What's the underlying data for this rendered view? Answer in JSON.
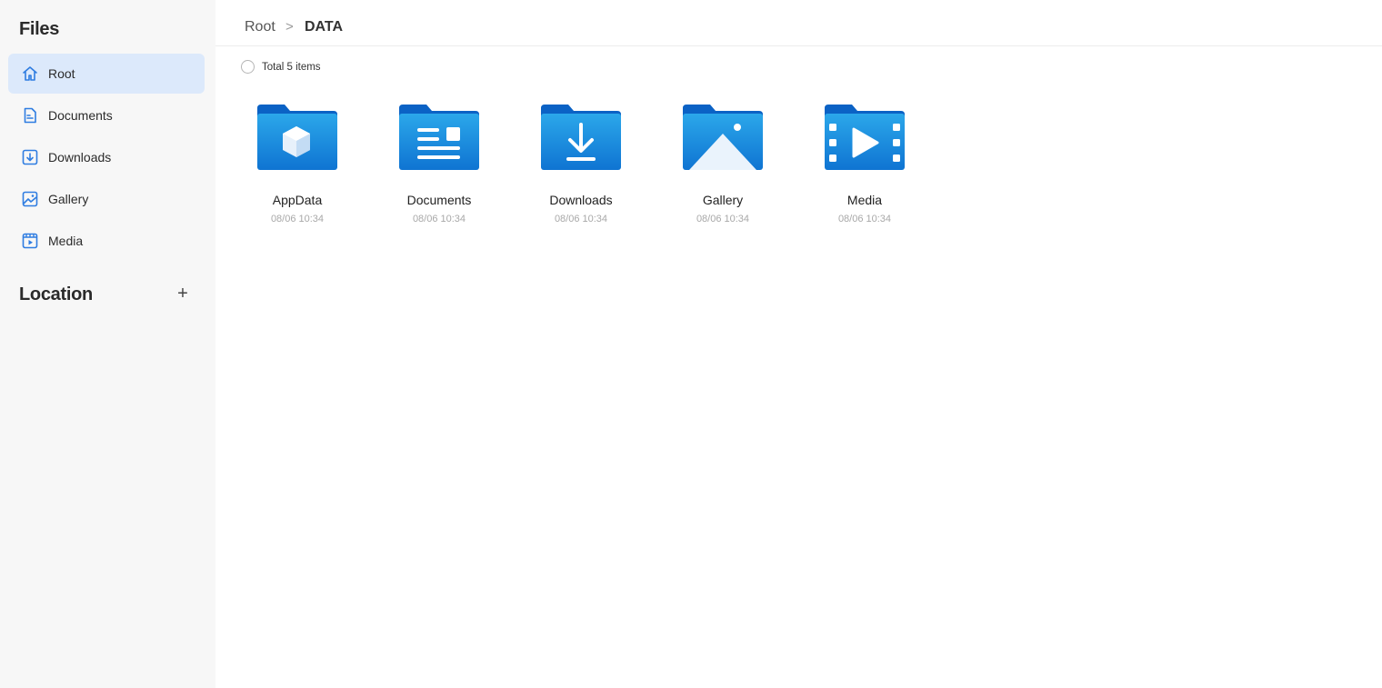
{
  "sidebar": {
    "title": "Files",
    "items": [
      {
        "label": "Root",
        "icon": "home-icon",
        "active": true
      },
      {
        "label": "Documents",
        "icon": "document-icon",
        "active": false
      },
      {
        "label": "Downloads",
        "icon": "download-icon",
        "active": false
      },
      {
        "label": "Gallery",
        "icon": "image-icon",
        "active": false
      },
      {
        "label": "Media",
        "icon": "video-icon",
        "active": false
      }
    ],
    "location_title": "Location",
    "add_location_label": "+"
  },
  "breadcrumb": {
    "root": "Root",
    "separator": ">",
    "current": "DATA"
  },
  "summary": {
    "text": "Total 5 items"
  },
  "folders": [
    {
      "name": "AppData",
      "date": "08/06 10:34",
      "icon": "app-data-folder-icon"
    },
    {
      "name": "Documents",
      "date": "08/06 10:34",
      "icon": "documents-folder-icon"
    },
    {
      "name": "Downloads",
      "date": "08/06 10:34",
      "icon": "downloads-folder-icon"
    },
    {
      "name": "Gallery",
      "date": "08/06 10:34",
      "icon": "gallery-folder-icon"
    },
    {
      "name": "Media",
      "date": "08/06 10:34",
      "icon": "media-folder-icon"
    }
  ],
  "colors": {
    "accent": "#2f7de1",
    "active_bg": "#dce9fb",
    "sidebar_bg": "#f7f7f7",
    "folder_dark": "#0b62c5",
    "folder_light": "#2aa3e6"
  }
}
